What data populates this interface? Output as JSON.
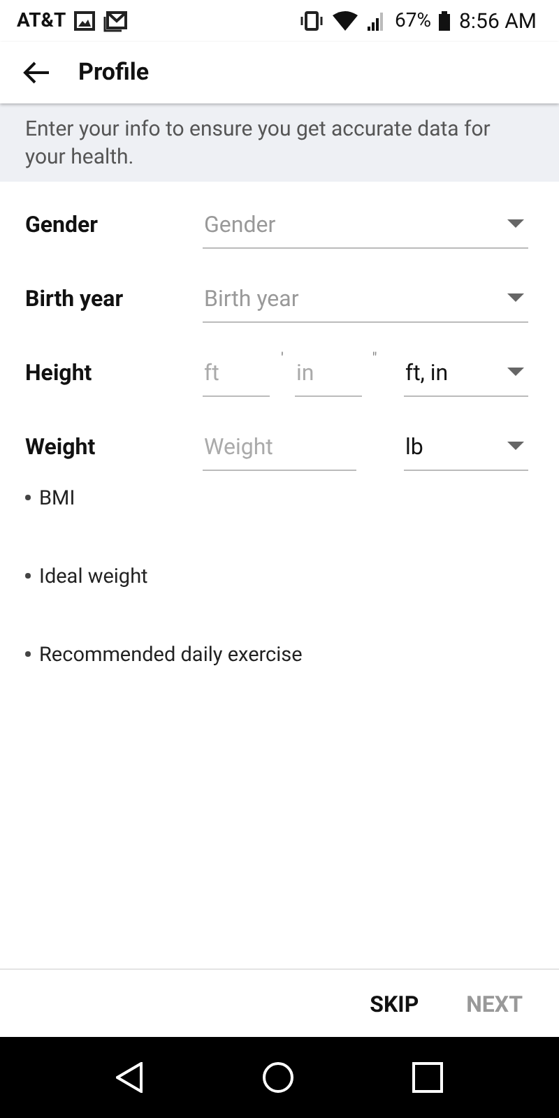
{
  "status_bar": {
    "carrier": "AT&T",
    "battery": "67%",
    "time": "8:56 AM"
  },
  "header": {
    "title": "Profile"
  },
  "info_banner": "Enter your info to ensure you get accurate data for your health.",
  "fields": [
    {
      "label": "Gender",
      "kind": "dropdown",
      "placeholder": "Gender"
    },
    {
      "label": "Birth year",
      "kind": "dropdown",
      "placeholder": "Birth year"
    },
    {
      "label": "Height",
      "kind": "split",
      "inputs": [
        {
          "placeholder": "ft",
          "mark": "'"
        },
        {
          "placeholder": "in",
          "mark": "\""
        }
      ],
      "unit": "ft, in"
    },
    {
      "label": "Weight",
      "kind": "single",
      "placeholder": "Weight",
      "unit": "lb"
    }
  ],
  "results": [
    "BMI",
    "Ideal weight",
    "Recommended daily exercise"
  ],
  "footer_buttons": [
    {
      "label": "SKIP",
      "disabled": false
    },
    {
      "label": "NEXT",
      "disabled": true
    }
  ]
}
